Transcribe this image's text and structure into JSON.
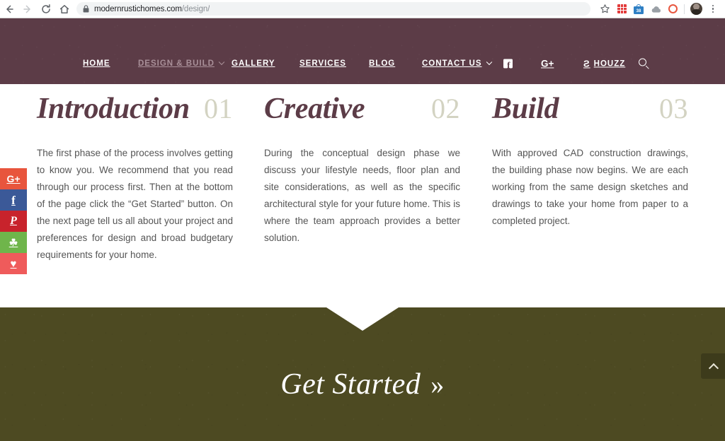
{
  "browser": {
    "back_label": "Back",
    "forward_label": "Forward",
    "reload_label": "Reload",
    "home_label": "Home",
    "url_domain": "modernrustichomes.com",
    "url_path": "/design/",
    "lock_icon": "lock-icon",
    "bookmark_icon": "star-icon",
    "extensions": [
      {
        "name": "red-grid-extension-icon",
        "badge": ""
      },
      {
        "name": "shopping-bag-extension-icon",
        "badge": "38"
      },
      {
        "name": "cloud-extension-icon",
        "badge": ""
      },
      {
        "name": "red-ring-extension-icon",
        "badge": ""
      }
    ],
    "profile_label": "Profile",
    "menu_label": "Customize and control"
  },
  "site_header": {
    "background_color": "#5c3c47",
    "nav": [
      {
        "id": "home",
        "label": "HOME",
        "has_caret": false,
        "muted": false
      },
      {
        "id": "design",
        "label": "DESIGN & BUILD",
        "has_caret": true,
        "muted": true
      },
      {
        "id": "gallery",
        "label": "GALLERY",
        "has_caret": false,
        "muted": false
      },
      {
        "id": "services",
        "label": "SERVICES",
        "has_caret": false,
        "muted": false
      },
      {
        "id": "blog",
        "label": "BLOG",
        "has_caret": false,
        "muted": false
      },
      {
        "id": "contact",
        "label": "CONTACT US",
        "has_caret": true,
        "muted": false
      }
    ],
    "social": {
      "facebook_icon": "facebook-icon",
      "gplus_label": "G+",
      "houzz_label": "HOUZZ",
      "houzz_glyph": "Ƨ",
      "search_icon": "search-icon"
    }
  },
  "social_rail": [
    {
      "id": "google-plus",
      "label": "G+",
      "color": "#e8553d",
      "glyph": "G+"
    },
    {
      "id": "facebook",
      "label": "Facebook",
      "color": "#3b5998",
      "glyph": "f"
    },
    {
      "id": "pinterest",
      "label": "Pinterest",
      "color": "#c8232c",
      "glyph": "P"
    },
    {
      "id": "evernote",
      "label": "Evernote",
      "color": "#6fb54b",
      "glyph": "☘"
    },
    {
      "id": "love",
      "label": "Love",
      "color": "#ef5b5b",
      "glyph": "♥"
    }
  ],
  "content": {
    "columns": [
      {
        "title": "Introduction",
        "number": "01",
        "body": "The first phase of the process involves getting to know you. We recommend that you read through our process first. Then at the bottom of the page click the “Get Started” button. On the next page tell us all about your project and preferences for design and broad budgetary requirements for your home."
      },
      {
        "title": "Creative",
        "number": "02",
        "body": "During the conceptual design phase we discuss your lifestyle needs, floor plan and site considerations, as well as the specific architectural style for your future home. This is where the team approach provides a better solution."
      },
      {
        "title": "Build",
        "number": "03",
        "body": "With approved CAD construction drawings, the building phase now begins. We are each working from the same design sketches and drawings to take your home from paper to a completed project."
      }
    ],
    "title_color": "#5c3c47",
    "number_color": "#d3d3c2"
  },
  "cta": {
    "label": "Get Started",
    "chevron": "»",
    "background_color": "#4d4a22"
  },
  "scroll_top": {
    "label": "Scroll to top",
    "icon": "chevron-up-icon"
  }
}
